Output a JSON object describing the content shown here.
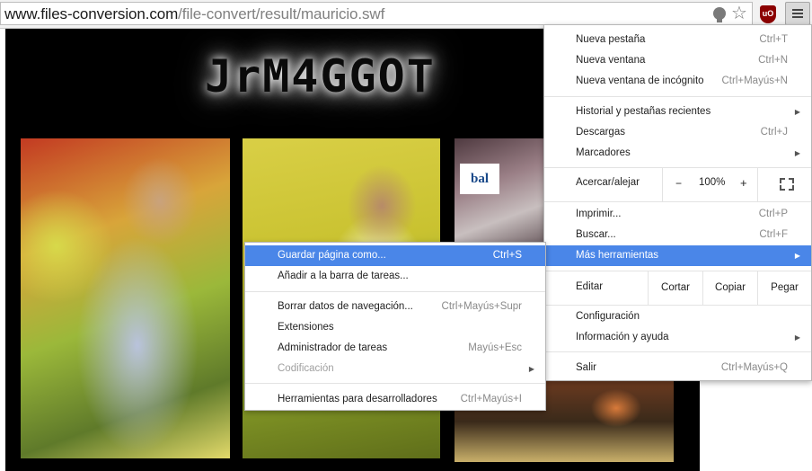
{
  "address_bar": {
    "url_host": "www.files-conversion.com",
    "url_path": "/file-convert/result/mauricio.swf"
  },
  "extensions": {
    "ublock_text": "uO"
  },
  "page": {
    "logo_text": "JrM4GGOT",
    "photo_sign_text": "bal"
  },
  "main_menu": {
    "new_tab": {
      "label": "Nueva pestaña",
      "shortcut": "Ctrl+T"
    },
    "new_window": {
      "label": "Nueva ventana",
      "shortcut": "Ctrl+N"
    },
    "incognito": {
      "label": "Nueva ventana de incógnito",
      "shortcut": "Ctrl+Mayús+N"
    },
    "history": {
      "label": "Historial y pestañas recientes"
    },
    "downloads": {
      "label": "Descargas",
      "shortcut": "Ctrl+J"
    },
    "bookmarks": {
      "label": "Marcadores"
    },
    "zoom": {
      "label": "Acercar/alejar",
      "minus": "−",
      "value": "100%",
      "plus": "+"
    },
    "print": {
      "label": "Imprimir...",
      "shortcut": "Ctrl+P"
    },
    "find": {
      "label": "Buscar...",
      "shortcut": "Ctrl+F"
    },
    "more_tools": {
      "label": "Más herramientas"
    },
    "edit": {
      "label": "Editar",
      "cut": "Cortar",
      "copy": "Copiar",
      "paste": "Pegar"
    },
    "settings": {
      "label": "Configuración"
    },
    "help": {
      "label": "Información y ayuda"
    },
    "exit": {
      "label": "Salir",
      "shortcut": "Ctrl+Mayús+Q"
    }
  },
  "sub_menu": {
    "save_page": {
      "label": "Guardar página como...",
      "shortcut": "Ctrl+S"
    },
    "add_to_taskbar": {
      "label": "Añadir a la barra de tareas..."
    },
    "clear_data": {
      "label": "Borrar datos de navegación...",
      "shortcut": "Ctrl+Mayús+Supr"
    },
    "extensions": {
      "label": "Extensiones"
    },
    "task_manager": {
      "label": "Administrador de tareas",
      "shortcut": "Mayús+Esc"
    },
    "encoding": {
      "label": "Codificación"
    },
    "dev_tools": {
      "label": "Herramientas para desarrolladores",
      "shortcut": "Ctrl+Mayús+I"
    }
  },
  "colors": {
    "highlight": "#4a86e8",
    "disabled_text": "#a0a0a0"
  }
}
